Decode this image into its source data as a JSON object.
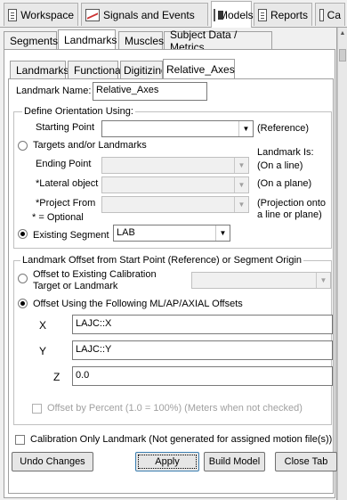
{
  "top_tabs": [
    {
      "label": "Workspace",
      "icon": "workspace-icon"
    },
    {
      "label": "Signals and Events",
      "icon": "signals-icon"
    },
    {
      "label": "Models",
      "icon": "models-icon"
    },
    {
      "label": "Reports",
      "icon": "reports-icon"
    },
    {
      "label": "Ca",
      "icon": "calc-icon"
    }
  ],
  "section_tabs": [
    "Segments",
    "Landmarks",
    "Muscles",
    "Subject Data / Metrics"
  ],
  "landmark_tabs": [
    "Landmarks",
    "Functional",
    "Digitizing",
    "Relative_Axes"
  ],
  "landmark_name": {
    "label": "Landmark Name:",
    "value": "Relative_Axes"
  },
  "orientation": {
    "legend": "Define Orientation Using:",
    "starting_point": "Starting Point",
    "reference": "(Reference)",
    "targets_radio": "Targets and/or Landmarks",
    "landmark_is": "Landmark Is:",
    "ending_point": "Ending Point",
    "on_line": "(On a line)",
    "lateral_object": "*Lateral object",
    "on_plane": "(On a plane)",
    "project_from": "*Project From",
    "projection_1": "(Projection onto",
    "projection_2": "a line or plane)",
    "optional": "* = Optional",
    "existing_segment": "Existing Segment",
    "segment_value": "LAB"
  },
  "offset": {
    "legend": "Landmark Offset from Start Point (Reference) or Segment Origin",
    "calib_radio_1": "Offset to Existing Calibration",
    "calib_radio_2": "Target or Landmark",
    "ml_radio": "Offset Using the Following ML/AP/AXIAL Offsets",
    "x_label": "X",
    "x_value": "LAJC::X",
    "y_label": "Y",
    "y_value": "LAJC::Y",
    "z_label": "Z",
    "z_value": "0.0",
    "percent_label": "Offset by Percent (1.0 = 100%) (Meters when not checked)"
  },
  "calibration_only": "Calibration Only Landmark (Not generated for assigned motion file(s))",
  "buttons": {
    "undo": "Undo Changes",
    "apply": "Apply",
    "build": "Build Model",
    "close": "Close Tab"
  }
}
